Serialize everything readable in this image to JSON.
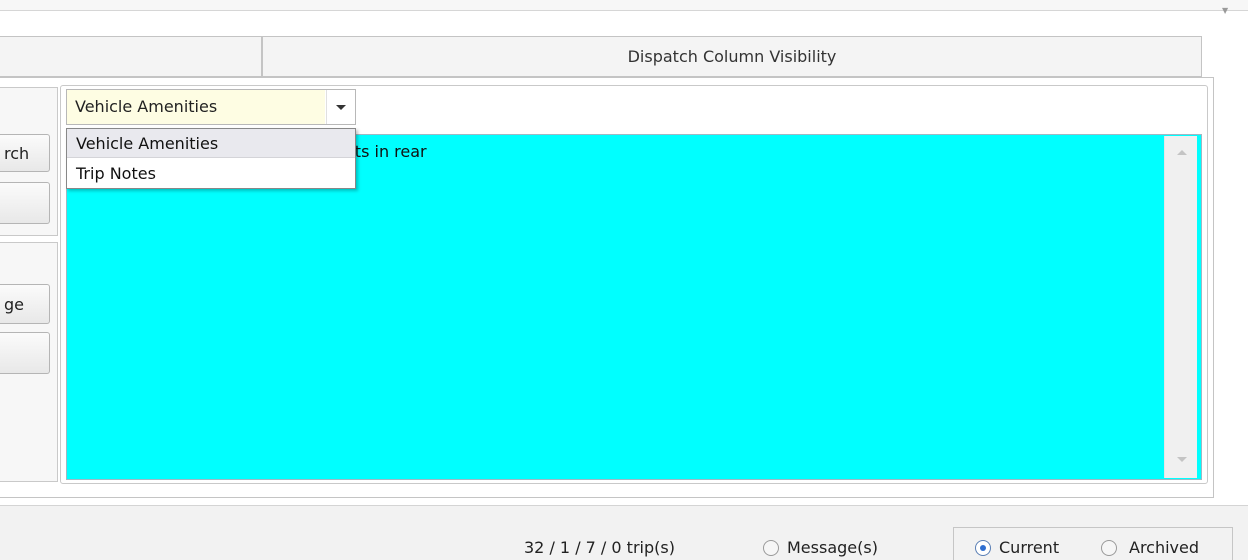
{
  "tabs": {
    "left_label": "",
    "right_label": "Dispatch Column Visibility"
  },
  "left_buttons": {
    "search_label": "rch",
    "button2_label": "",
    "message_label": "ge",
    "button4_label": ""
  },
  "notes_selector": {
    "selected": "Vehicle Amenities",
    "options": [
      "Vehicle Amenities",
      "Trip Notes"
    ]
  },
  "memo": {
    "visible_text": "ats in rear",
    "background_color": "#00ffff"
  },
  "status": {
    "trip_counts": "32 / 1 / 7 / 0 trip(s)",
    "message_label": "Message(s)",
    "current_label": "Current",
    "archived_label": "Archived",
    "selected_view": "Current"
  }
}
